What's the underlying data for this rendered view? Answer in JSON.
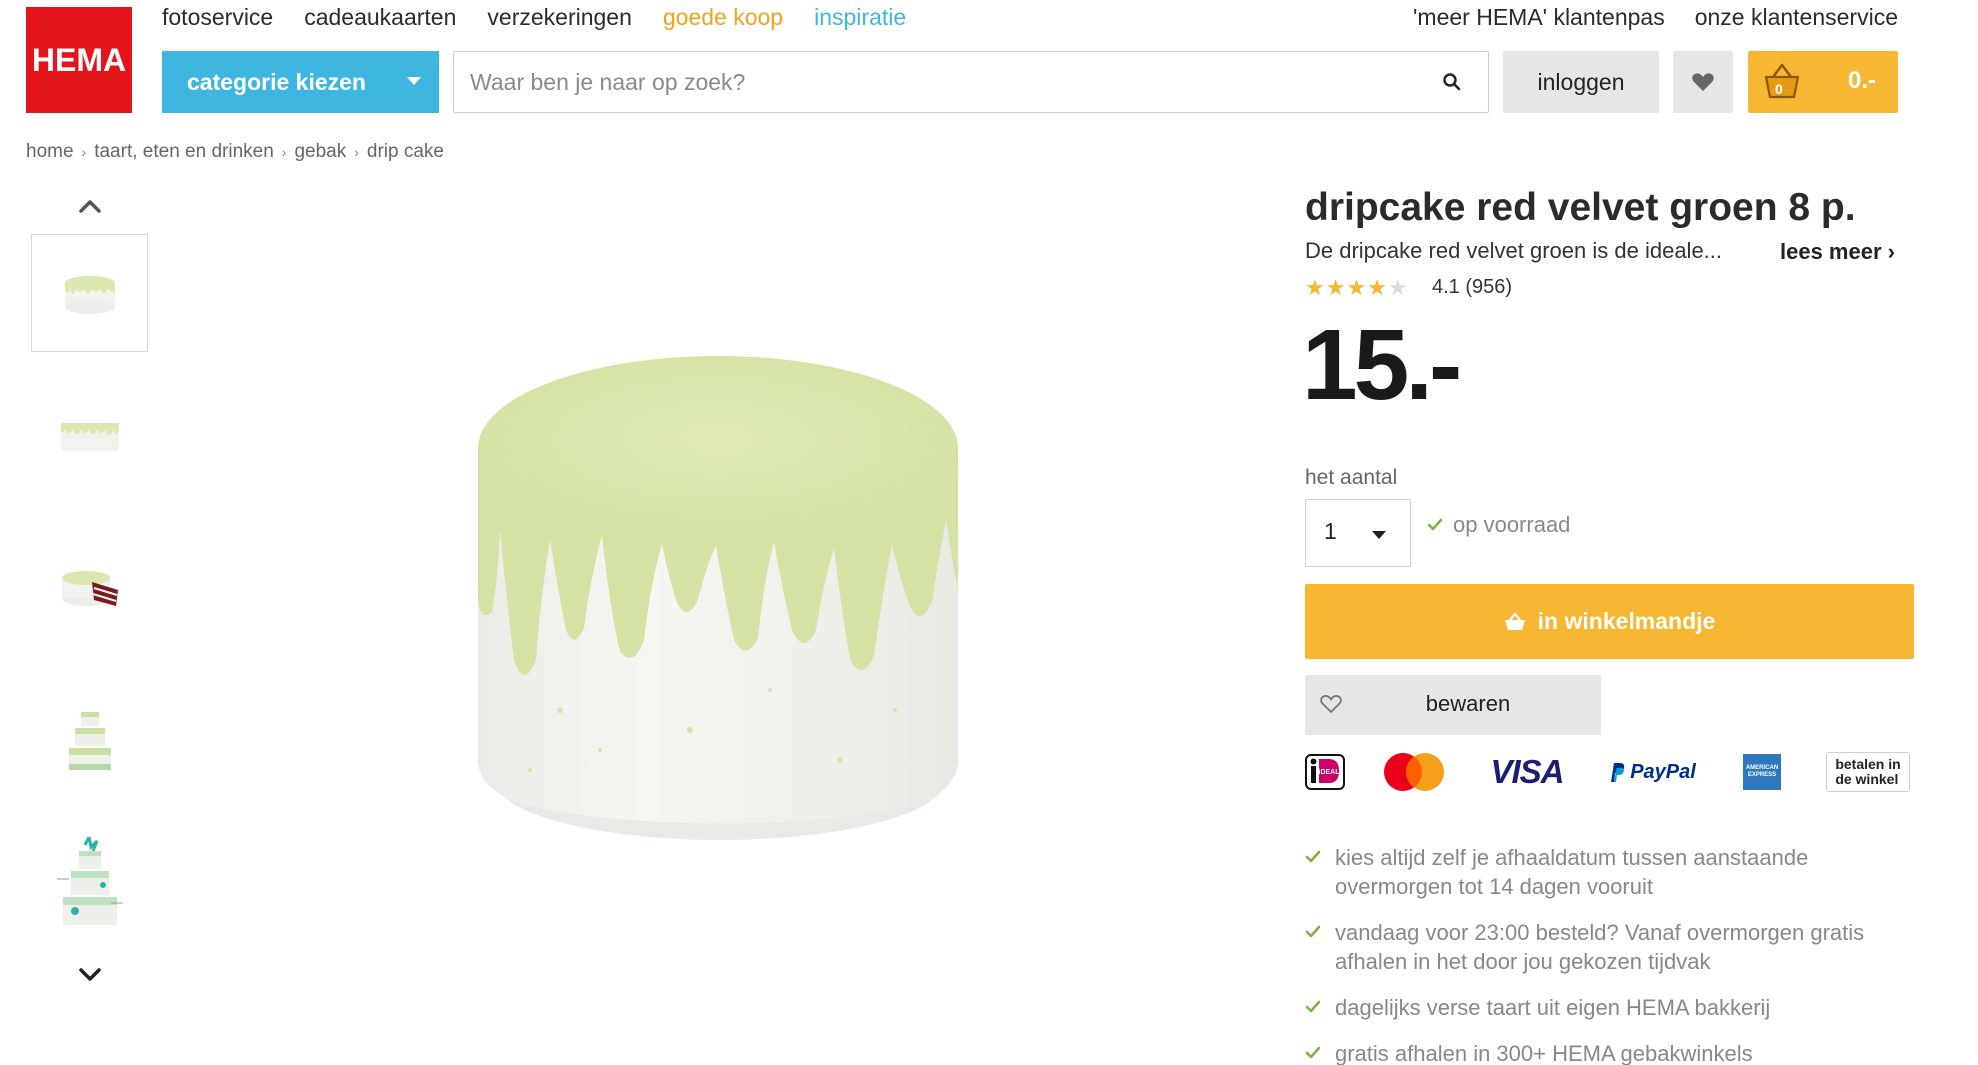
{
  "header": {
    "logo_text": "HEMA",
    "nav": [
      {
        "label": "fotoservice",
        "color": "#2b2b2b"
      },
      {
        "label": "cadeaukaarten",
        "color": "#2b2b2b"
      },
      {
        "label": "verzekeringen",
        "color": "#2b2b2b"
      },
      {
        "label": "goede koop",
        "color": "#f2a31b"
      },
      {
        "label": "inspiratie",
        "color": "#3fb6e0"
      }
    ],
    "right_links": [
      "'meer HEMA' klantenpas",
      "onze klantenservice"
    ],
    "category_label": "categorie kiezen",
    "search_placeholder": "Waar ben je naar op zoek?",
    "login_label": "inloggen",
    "cart_count": "0",
    "cart_total": "0.-",
    "colors": {
      "brand_red": "#e3151a",
      "accent_blue": "#3fb6e0",
      "accent_yellow": "#f7b732"
    }
  },
  "breadcrumb": [
    "home",
    "taart, eten en drinken",
    "gebak",
    "drip cake"
  ],
  "product": {
    "title": "dripcake red velvet groen 8 p.",
    "description": "De dripcake red velvet groen is de ideale...",
    "read_more": "lees meer",
    "rating_value": 4.1,
    "rating_text": "4.1 (956)",
    "price": "15.-",
    "quantity_label": "het aantal",
    "quantity_value": "1",
    "stock_text": "op voorraad",
    "add_to_cart_label": "in winkelmandje",
    "save_label": "bewaren"
  },
  "payments": {
    "instore_line1": "betalen in",
    "instore_line2": "de winkel",
    "visa": "VISA",
    "paypal": "PayPal",
    "amex_line1": "AMERICAN",
    "amex_line2": "EXPRESS",
    "ideal": "iDEAL"
  },
  "usps": [
    "kies altijd zelf je afhaaldatum tussen aanstaande overmorgen tot 14 dagen vooruit",
    "vandaag voor 23:00 besteld? Vanaf overmorgen gratis afhalen in het door jou gekozen tijdvak",
    "dagelijks verse taart uit eigen HEMA bakkerij",
    "gratis afhalen in 300+ HEMA gebakwinkels"
  ]
}
